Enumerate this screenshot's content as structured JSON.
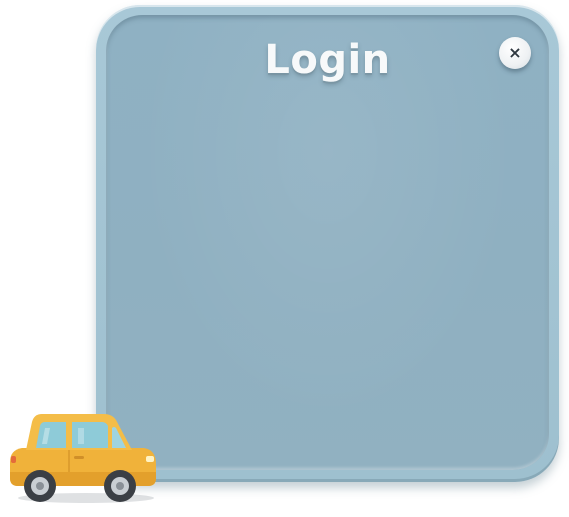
{
  "dialog": {
    "title": "Login",
    "close_symbol": "×",
    "close_icon": "close-icon"
  },
  "decoration": {
    "icon": "toy-car-icon"
  },
  "colors": {
    "panel": "#a3c3d2",
    "panel_face": "#8fb1c3",
    "title": "#f7f9fa",
    "close_button": "#ffffff",
    "car_body": "#f2b63a",
    "car_window": "#8ecbd8"
  }
}
